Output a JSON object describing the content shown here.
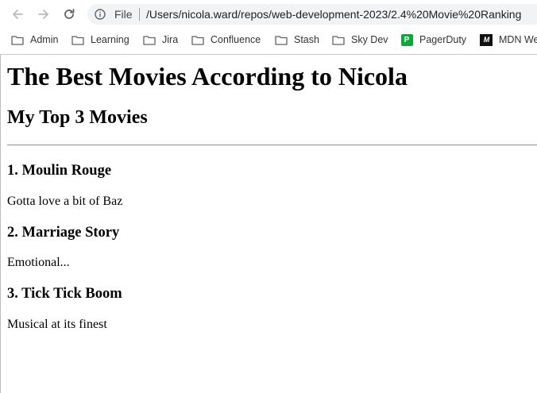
{
  "browser": {
    "url_scheme": "File",
    "url": "/Users/nicola.ward/repos/web-development-2023/2.4%20Movie%20Ranking",
    "bookmarks": [
      {
        "label": "Admin",
        "icon": "folder-icon"
      },
      {
        "label": "Learning",
        "icon": "folder-icon"
      },
      {
        "label": "Jira",
        "icon": "folder-icon"
      },
      {
        "label": "Confluence",
        "icon": "folder-icon"
      },
      {
        "label": "Stash",
        "icon": "folder-icon"
      },
      {
        "label": "Sky Dev",
        "icon": "folder-icon"
      },
      {
        "label": "PagerDuty",
        "icon": "pagerduty-icon",
        "badge": "P"
      },
      {
        "label": "MDN Web Docs",
        "icon": "mdn-icon",
        "badge": "M"
      }
    ]
  },
  "page": {
    "title": "The Best Movies According to Nicola",
    "subtitle": "My Top 3 Movies",
    "movies": [
      {
        "heading": "1. Moulin Rouge",
        "comment": "Gotta love a bit of Baz"
      },
      {
        "heading": "2. Marriage Story",
        "comment": "Emotional..."
      },
      {
        "heading": "3. Tick Tick Boom",
        "comment": "Musical at its finest"
      }
    ]
  },
  "colors": {
    "pagerduty_green": "#06ac38",
    "omnibox_bg": "#f1f3f4"
  }
}
